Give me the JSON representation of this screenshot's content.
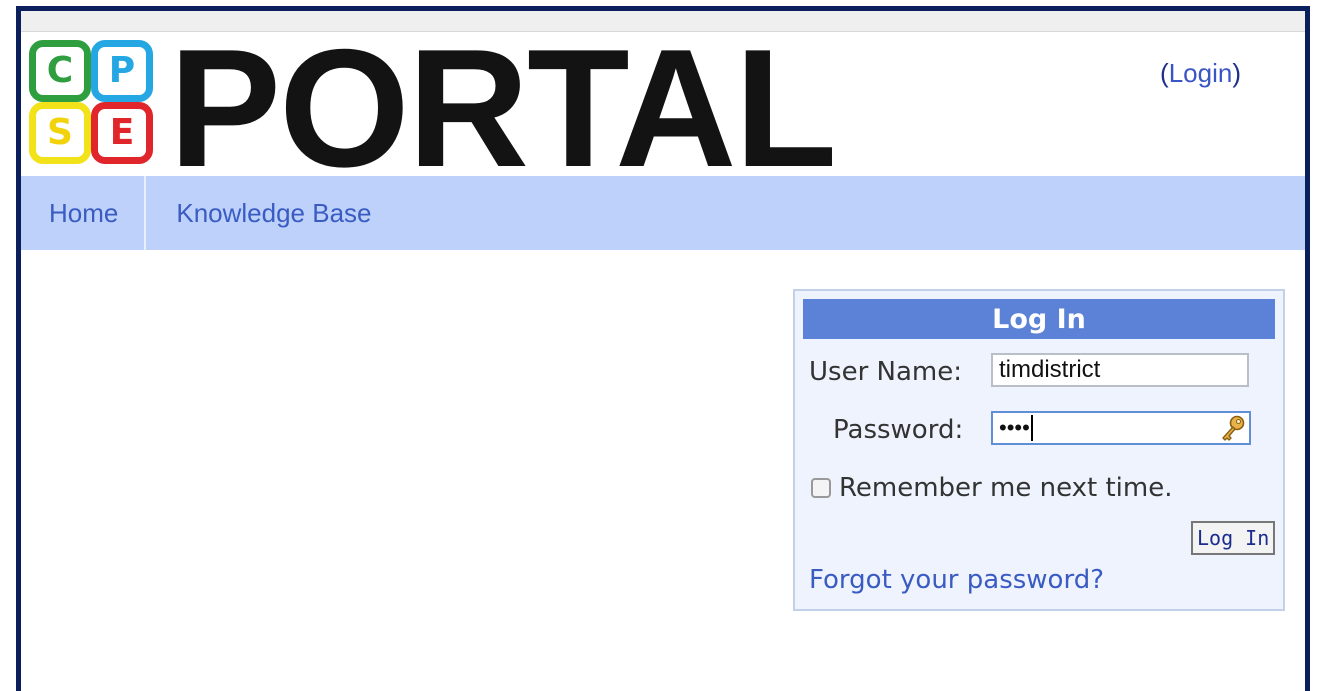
{
  "header": {
    "logo_letters": [
      "C",
      "P",
      "S",
      "E"
    ],
    "wordmark": "PORTAL",
    "login_open": "(",
    "login_link": "Login",
    "login_close": ")"
  },
  "nav": {
    "items": [
      {
        "label": "Home"
      },
      {
        "label": "Knowledge Base"
      }
    ]
  },
  "login_panel": {
    "title": "Log In",
    "user_label": "User Name:",
    "user_value": "timdistrict",
    "password_label": "Password:",
    "password_masked": "••••",
    "remember_label": "Remember me next time.",
    "submit_label": "Log In",
    "forgot_link": "Forgot your password?"
  },
  "colors": {
    "frame": "#0b1f5c",
    "nav_background": "#bdd1fb",
    "panel_title_bg": "#5b82d6",
    "link": "#3a5cc2",
    "logo_c": "#2e9e3e",
    "logo_p": "#25a7e3",
    "logo_s": "#f2e21a",
    "logo_e": "#e0262b"
  },
  "icons": {
    "password_field": "key-icon"
  }
}
